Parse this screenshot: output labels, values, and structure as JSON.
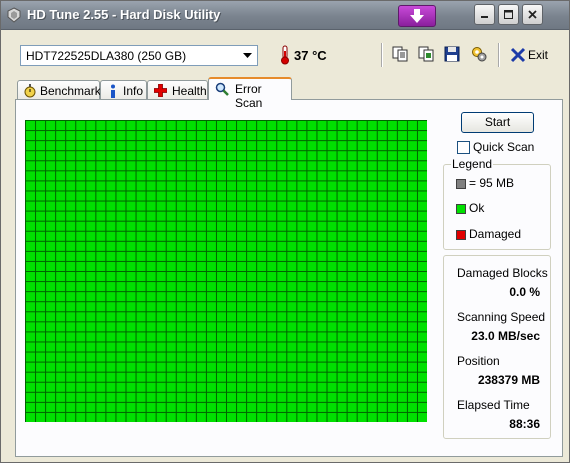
{
  "window": {
    "title": "HD Tune 2.55 - Hard Disk Utility"
  },
  "toolbar": {
    "drive": "HDT722525DLA380 (250 GB)",
    "temperature": "37 °C",
    "exit_label": "Exit"
  },
  "tabs": [
    {
      "label": "Benchmark",
      "icon": "stopwatch-icon"
    },
    {
      "label": "Info",
      "icon": "info-icon"
    },
    {
      "label": "Health",
      "icon": "red-cross-icon"
    },
    {
      "label": "Error Scan",
      "icon": "magnifier-icon",
      "active": true
    }
  ],
  "scan": {
    "start_label": "Start",
    "quick_scan_label": "Quick Scan",
    "quick_scan_checked": false,
    "grid": {
      "cols": 40,
      "rows": 30,
      "all_blocks_status": "ok"
    }
  },
  "legend": {
    "title": "Legend",
    "items": [
      {
        "label": "= 95 MB",
        "color": "#808080"
      },
      {
        "label": "Ok",
        "color": "#00e000"
      },
      {
        "label": "Damaged",
        "color": "#e00000"
      }
    ]
  },
  "stats": {
    "damaged_blocks_label": "Damaged Blocks",
    "damaged_blocks_value": "0.0 %",
    "scanning_speed_label": "Scanning Speed",
    "scanning_speed_value": "23.0 MB/sec",
    "position_label": "Position",
    "position_value": "238379 MB",
    "elapsed_time_label": "Elapsed Time",
    "elapsed_time_value": "88:36"
  },
  "colors": {
    "ok_block": "#00e000",
    "grid_line": "#006400"
  }
}
